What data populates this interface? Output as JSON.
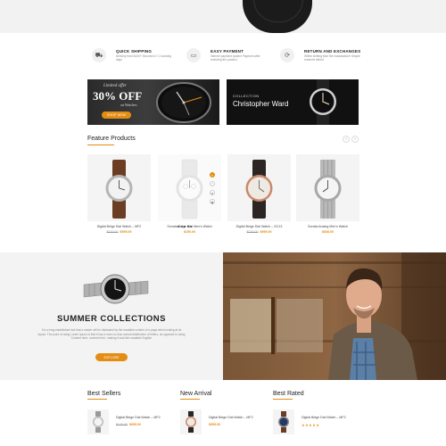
{
  "features": [
    {
      "icon": "truck-icon",
      "glyph": "⛟",
      "title": "QUICK SHIPPING",
      "sub": "Delivery from $100+ Secured in 7-3 working days"
    },
    {
      "icon": "credit-card-icon",
      "glyph": "▭",
      "title": "EASY PAYMENT",
      "sub": "Internet payment system Payment after receiving the product"
    },
    {
      "icon": "refresh-icon",
      "glyph": "⟳",
      "title": "RETURN AND EXCHANGES",
      "sub": "Within shitting from the manufacturer Simple returned refund"
    }
  ],
  "banners": {
    "left": {
      "kicker": "Limited offer",
      "headline": "30% OFF",
      "sub": "on Watches",
      "button": "SHOP NOW"
    },
    "right": {
      "kicker": "COLLECTION",
      "headline": "Christopher Ward"
    }
  },
  "feature_products": {
    "title": "Feature Products",
    "prev": "‹",
    "next": "›",
    "items": [
      {
        "name": "Digital Beige Dial Watch – MF2",
        "old_price": "$120.00",
        "price": "$995.00",
        "strap": "#6b3e24"
      },
      {
        "name": "Sonata Beige Dial Men's Watch",
        "old_price": "",
        "price": "$150.00",
        "strap": "#e9e9e9"
      },
      {
        "name": "Digital Beige Dial Watch – GC13",
        "old_price": "$120.00",
        "price": "$995.00",
        "strap": "#2b2623"
      },
      {
        "name": "Sonata Analog Men's Watch",
        "old_price": "",
        "price": "$658.00",
        "strap": "#b9b9b9"
      }
    ]
  },
  "summer": {
    "title": "SUMMER COLLECTIONS",
    "desc": "It is a long established fact that a reader will be distracted by the readable content of a page when looking at its layout. The point of using Lorem Ipsum is that it has a more-or-less normal distribution of letters, as opposed to using 'Content here, content here', making it look like readable English.",
    "button": "EXPLORE"
  },
  "lists": [
    {
      "title": "Best Sellers",
      "item": {
        "name": "Digital Beige Dial Watch – MF2",
        "old_price": "$120.00",
        "price": "$995.00"
      }
    },
    {
      "title": "New Arrival",
      "item": {
        "name": "Digital Beige Dial Watch – MF2",
        "old_price": "",
        "price": "$995.00"
      }
    },
    {
      "title": "Best Rated",
      "item": {
        "name": "Digital Beige Dial Watch – MF2",
        "rating": 5
      }
    }
  ],
  "colors": {
    "accent": "#e48d13"
  }
}
